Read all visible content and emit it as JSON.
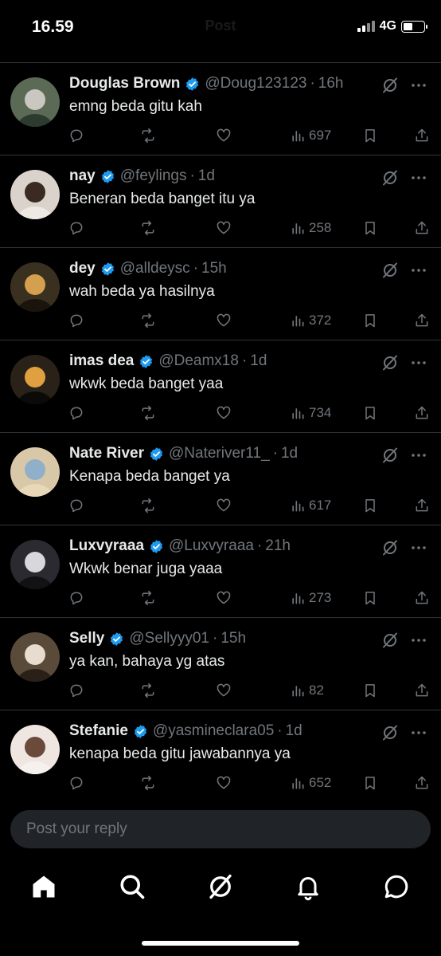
{
  "status": {
    "time": "16.59",
    "network": "4G",
    "header_faint": "Post"
  },
  "replies": [
    {
      "name": "Douglas Brown",
      "handle": "@Doug123123",
      "time": "16h",
      "text": "emng beda gitu kah",
      "views": "697",
      "avatar": {
        "colors": [
          "#5a6a55",
          "#c9c7c0",
          "#2c3a30"
        ]
      }
    },
    {
      "name": "nay",
      "handle": "@feylings",
      "time": "1d",
      "text": "Beneran beda banget itu ya",
      "views": "258",
      "avatar": {
        "colors": [
          "#d9d3cc",
          "#3b2a22",
          "#efe9e4"
        ]
      }
    },
    {
      "name": "dey",
      "handle": "@alldeysc",
      "time": "15h",
      "text": "wah beda ya hasilnya",
      "views": "372",
      "avatar": {
        "colors": [
          "#3a3020",
          "#d4a050",
          "#1a140c"
        ]
      }
    },
    {
      "name": "imas dea",
      "handle": "@Deamx18",
      "time": "1d",
      "text": "wkwk beda banget yaa",
      "views": "734",
      "avatar": {
        "colors": [
          "#2a2218",
          "#e0a040",
          "#0c0a08"
        ]
      }
    },
    {
      "name": "Nate River",
      "handle": "@Nateriver11_",
      "time": "1d",
      "text": "Kenapa beda banget ya",
      "views": "617",
      "avatar": {
        "colors": [
          "#d9c8a8",
          "#8fb0c8",
          "#e8d8b8"
        ]
      }
    },
    {
      "name": "Luxvyraaa",
      "handle": "@Luxvyraaa",
      "time": "21h",
      "text": "Wkwk benar juga yaaa",
      "views": "273",
      "avatar": {
        "colors": [
          "#2a2a30",
          "#d8d8dc",
          "#121214"
        ]
      }
    },
    {
      "name": "Selly",
      "handle": "@Sellyyy01",
      "time": "15h",
      "text": "ya kan, bahaya yg atas",
      "views": "82",
      "avatar": {
        "colors": [
          "#5a4a3a",
          "#e8dccf",
          "#2a2018"
        ]
      }
    },
    {
      "name": "Stefanie",
      "handle": "@yasmineclara05",
      "time": "1d",
      "text": "kenapa beda gitu jawabannya ya",
      "views": "652",
      "avatar": {
        "colors": [
          "#efe6e2",
          "#6a4a3a",
          "#f6f0ee"
        ]
      }
    }
  ],
  "compose": {
    "placeholder": "Post your reply"
  },
  "tabbar": {
    "icons": [
      "home-icon",
      "search-icon",
      "grok-icon",
      "notifications-icon",
      "messages-icon"
    ]
  },
  "colors": {
    "background": "#000000",
    "text": "#e7e9ea",
    "muted": "#71767b",
    "verified": "#1d9bf0",
    "divider": "#2f3336"
  }
}
